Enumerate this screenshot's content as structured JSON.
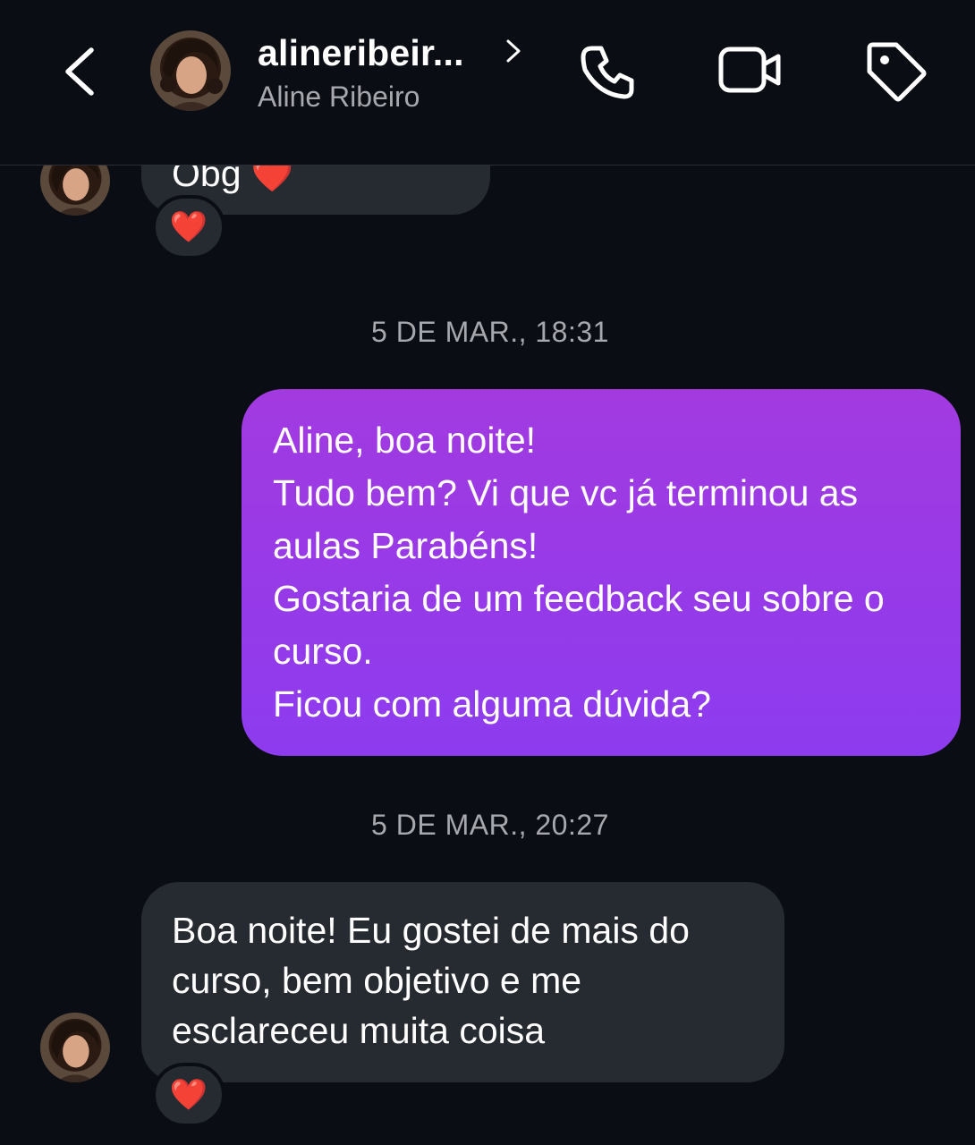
{
  "header": {
    "username": "alineribeir...",
    "full_name": "Aline Ribeiro",
    "back_icon": "chevron-left-icon",
    "call_icon": "phone-icon",
    "video_icon": "video-camera-icon",
    "tag_icon": "tag-icon"
  },
  "messages": {
    "first": {
      "text": "Obg",
      "reaction": "❤️",
      "emoji": "❤️"
    },
    "timestamp_1": "5 DE MAR., 18:31",
    "sent": {
      "lines": [
        "Aline, boa noite!",
        "Tudo bem? Vi que vc já terminou as aulas Parabéns!",
        "Gostaria de um feedback seu sobre o curso.",
        "Ficou com alguma dúvida?"
      ]
    },
    "timestamp_2": "5 DE MAR., 20:27",
    "reply": {
      "text": "Boa noite! Eu gostei de mais do curso, bem objetivo e me esclareceu muita coisa",
      "reaction": "❤️"
    }
  },
  "colors": {
    "background": "#0b0d14",
    "incoming_bubble": "#262a31",
    "outgoing_gradient_top": "#a23ae0",
    "outgoing_gradient_bottom": "#8d3bef",
    "secondary_text": "#a7a8ad"
  }
}
